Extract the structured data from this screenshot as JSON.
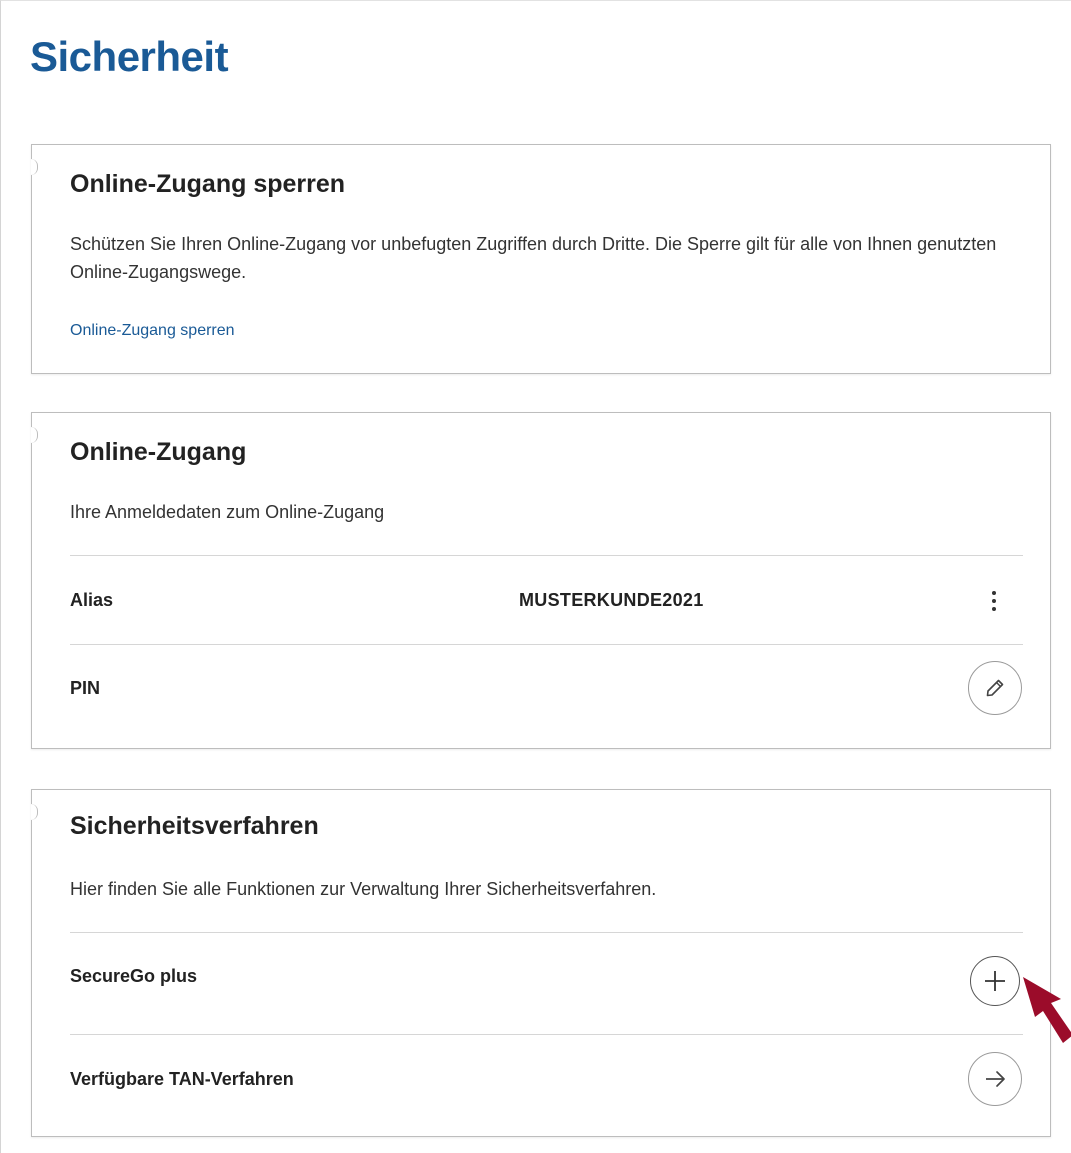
{
  "page": {
    "title": "Sicherheit"
  },
  "lock_card": {
    "title": "Online-Zugang sperren",
    "description": "Schützen Sie Ihren Online-Zugang vor unbefugten Zugriffen durch Dritte. Die Sperre gilt für alle von Ihnen genutzten Online-Zugangswege.",
    "link_label": "Online-Zugang sperren"
  },
  "access_card": {
    "title": "Online-Zugang",
    "description": "Ihre Anmeldedaten zum Online-Zugang",
    "rows": [
      {
        "label": "Alias",
        "value": "MUSTERKUNDE2021",
        "action_icon": "more-vertical-icon"
      },
      {
        "label": "PIN",
        "value": "",
        "action_icon": "pencil-icon"
      }
    ]
  },
  "security_card": {
    "title": "Sicherheitsverfahren",
    "description": "Hier finden Sie alle Funktionen zur Verwaltung Ihrer Sicherheitsverfahren.",
    "rows": [
      {
        "label": "SecureGo plus",
        "action_icon": "plus-icon"
      },
      {
        "label": "Verfügbare TAN-Verfahren",
        "action_icon": "arrow-right-icon"
      }
    ]
  },
  "colors": {
    "brand_blue": "#1a5a96",
    "annotation_arrow": "#9b0c2a",
    "border": "#bdbdbd"
  }
}
